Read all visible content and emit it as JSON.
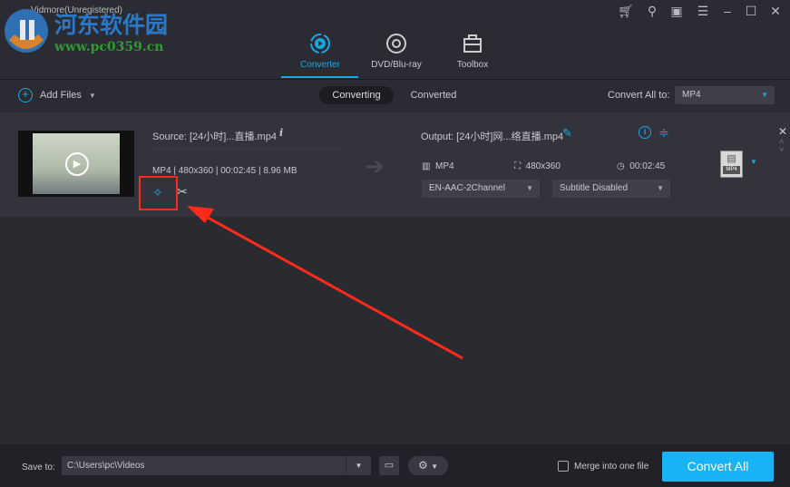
{
  "app": {
    "title": "Vidmore(Unregistered)"
  },
  "watermark": {
    "name": "河东软件园",
    "url": "www.pc0359.cn"
  },
  "tabs": [
    {
      "label": "Converter",
      "active": true
    },
    {
      "label": "DVD/Blu-ray"
    },
    {
      "label": "Toolbox"
    }
  ],
  "toolbar": {
    "add_files": "Add Files",
    "converting": "Converting",
    "converted": "Converted",
    "convert_all_to_label": "Convert All to:",
    "convert_all_to_value": "MP4"
  },
  "file": {
    "source": "Source: [24小时]...直播.mp4",
    "meta": "MP4 | 480x360 | 00:02:45 | 8.96 MB",
    "output": "Output: [24小时]网...络直播.mp4",
    "out_format": "MP4",
    "out_resolution": "480x360",
    "out_duration": "00:02:45",
    "audio": "EN-AAC-2Channel",
    "subtitle": "Subtitle Disabled",
    "format_badge": "MP4"
  },
  "bottom": {
    "save_to_label": "Save to:",
    "save_path": "C:\\Users\\pc\\Videos",
    "merge_label": "Merge into one file",
    "convert_all": "Convert All"
  },
  "colors": {
    "accent": "#1aa6e0",
    "convert_btn": "#17b3f5",
    "annotation": "#ff2a1a"
  }
}
